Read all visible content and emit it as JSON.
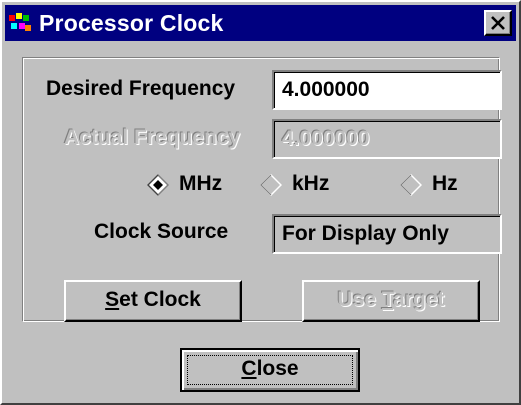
{
  "window": {
    "title": "Processor Clock",
    "close_glyph": "×",
    "icon": "app-chip-icon"
  },
  "fields": {
    "desired_label": "Desired Frequency",
    "desired_value": "4.000000",
    "actual_label": "Actual Frequency",
    "actual_value": "4.000000",
    "clock_source_label": "Clock Source",
    "clock_source_value": "For Display Only"
  },
  "units": {
    "selected": "MHz",
    "options": [
      {
        "label": "MHz",
        "selected": true
      },
      {
        "label": "kHz",
        "selected": false
      },
      {
        "label": "Hz",
        "selected": false
      }
    ]
  },
  "buttons": {
    "set_clock": {
      "mnemonic": "S",
      "rest": "et Clock"
    },
    "use_target": {
      "prefix": "Use ",
      "mnemonic": "T",
      "rest": "arget"
    },
    "close": {
      "mnemonic": "C",
      "rest": "lose"
    }
  },
  "colors": {
    "titlebar": "#000080",
    "face": "#c0c0c0",
    "field_bg": "#ffffff"
  }
}
